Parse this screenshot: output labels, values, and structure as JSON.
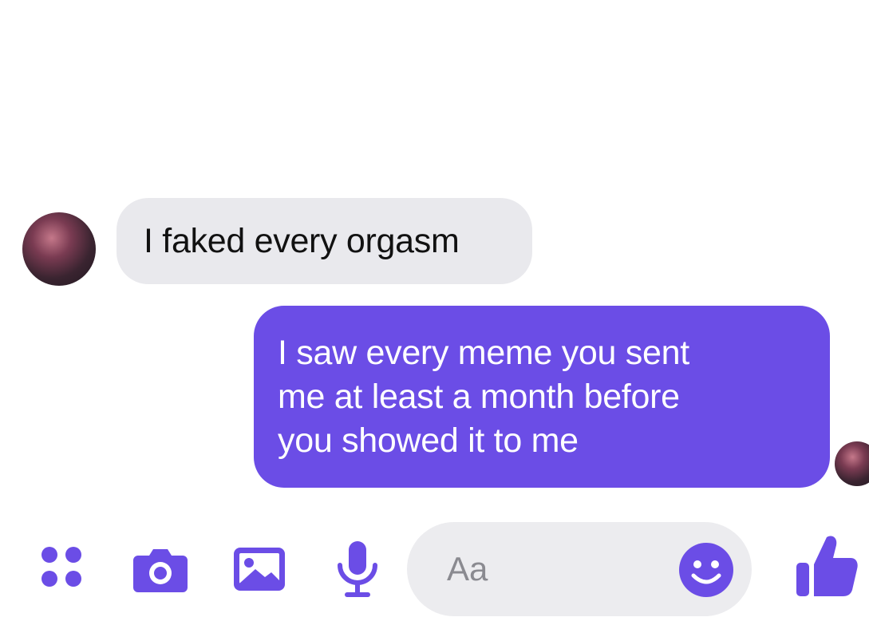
{
  "conversation": {
    "messages": [
      {
        "direction": "incoming",
        "text": "I faked every orgasm"
      },
      {
        "direction": "outgoing",
        "text": "I saw every meme you sent\nme at least a month before\nyou showed it to me"
      }
    ]
  },
  "composer": {
    "placeholder": "Aa",
    "icons": [
      "more-dots-icon",
      "camera-icon",
      "image-icon",
      "microphone-icon",
      "emoji-icon",
      "thumbs-up-icon"
    ]
  },
  "colors": {
    "accent": "#6b4de6",
    "incoming_bubble": "#e9e9ed",
    "composer_field": "#ececef"
  }
}
